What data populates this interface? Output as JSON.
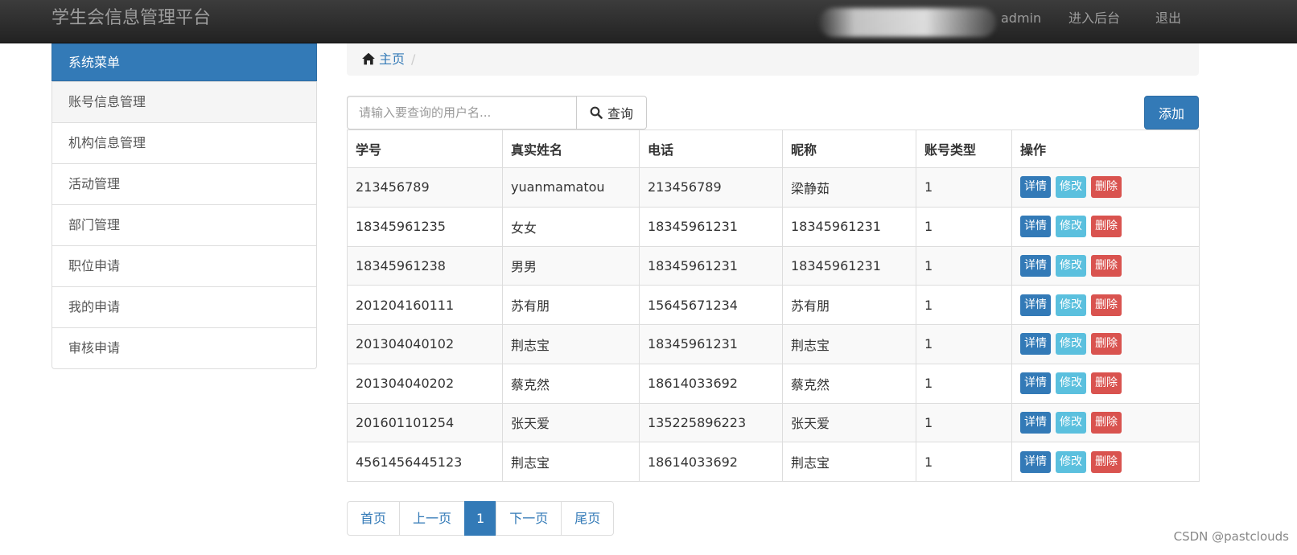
{
  "navbar": {
    "brand": "学生会信息管理平台",
    "user": "admin",
    "backend": "进入后台",
    "logout": "退出"
  },
  "sidebar": {
    "header": "系统菜单",
    "items": [
      {
        "label": "账号信息管理"
      },
      {
        "label": "机构信息管理"
      },
      {
        "label": "活动管理"
      },
      {
        "label": "部门管理"
      },
      {
        "label": "职位申请"
      },
      {
        "label": "我的申请"
      },
      {
        "label": "审核申请"
      }
    ]
  },
  "breadcrumb": {
    "home": "主页",
    "separator": "/",
    "home_icon": "home-icon"
  },
  "search": {
    "placeholder": "请输入要查询的用户名...",
    "value": "",
    "button": "查询",
    "icon": "search-icon"
  },
  "add_button": "添加",
  "table": {
    "headers": [
      "学号",
      "真实姓名",
      "电话",
      "昵称",
      "账号类型",
      "操作"
    ],
    "rows": [
      [
        "213456789",
        "yuanmamatou",
        "213456789",
        "梁静茹",
        "1"
      ],
      [
        "18345961235",
        "女女",
        "18345961231",
        "18345961231",
        "1"
      ],
      [
        "18345961238",
        "男男",
        "18345961231",
        "18345961231",
        "1"
      ],
      [
        "201204160111",
        "苏有朋",
        "15645671234",
        "苏有朋",
        "1"
      ],
      [
        "201304040102",
        "荆志宝",
        "18345961231",
        "荆志宝",
        "1"
      ],
      [
        "201304040202",
        "蔡克然",
        "18614033692",
        "蔡克然",
        "1"
      ],
      [
        "201601101254",
        "张天爱",
        "135225896223",
        "张天爱",
        "1"
      ],
      [
        "4561456445123",
        "荆志宝",
        "18614033692",
        "荆志宝",
        "1"
      ]
    ],
    "actions": {
      "detail": "详情",
      "edit": "修改",
      "delete": "删除"
    }
  },
  "pagination": {
    "first": "首页",
    "prev": "上一页",
    "current": "1",
    "next": "下一页",
    "last": "尾页"
  },
  "watermark": "CSDN @pastclouds",
  "colors": {
    "primary": "#337ab7",
    "info": "#5bc0de",
    "danger": "#d9534f",
    "navbar": "#222222"
  }
}
